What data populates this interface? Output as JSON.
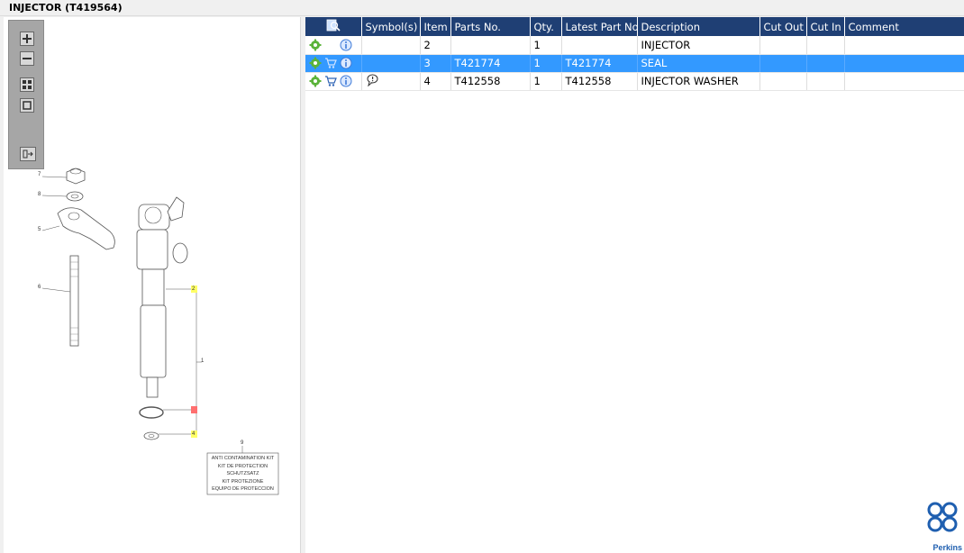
{
  "window": {
    "title": "INJECTOR (T419564)"
  },
  "diagram": {
    "callouts": [
      "7",
      "8",
      "5",
      "6",
      "2",
      "1",
      "4",
      "9"
    ],
    "kit_label": [
      "ANTI CONTAMINATION KIT",
      "KIT DE PROTECTION",
      "SCHUTZSATZ",
      "KIT PROTEZIONE",
      "EQUIPO DE PROTECCION"
    ],
    "zoom_tools": [
      "zoom-in-icon",
      "zoom-out-icon",
      "fit-all-icon",
      "fit-window-icon",
      "toggle-panel-icon"
    ]
  },
  "table": {
    "columns": [
      "Symbol(s)",
      "Item",
      "Parts No.",
      "Qty.",
      "Latest Part No.",
      "Description",
      "Cut Out",
      "Cut In",
      "Comment"
    ],
    "rows": [
      {
        "item": "2",
        "part_no": "",
        "qty": "1",
        "latest_part_no": "",
        "description": "INJECTOR",
        "cut_out": "",
        "cut_in": "",
        "comment": "",
        "has_cart": false,
        "has_note": false,
        "selected": false
      },
      {
        "item": "3",
        "part_no": "T421774",
        "qty": "1",
        "latest_part_no": "T421774",
        "description": "SEAL",
        "cut_out": "",
        "cut_in": "",
        "comment": "",
        "has_cart": true,
        "has_note": false,
        "selected": true
      },
      {
        "item": "4",
        "part_no": "T412558",
        "qty": "1",
        "latest_part_no": "T412558",
        "description": "INJECTOR WASHER",
        "cut_out": "",
        "cut_in": "",
        "comment": "",
        "has_cart": true,
        "has_note": true,
        "selected": false
      }
    ]
  },
  "brand": {
    "name": "Perkins",
    "color": "#1f5fb0"
  },
  "colors": {
    "header_bg": "#1f3f74",
    "selected_row": "#3399ff",
    "callout_yellow": "#ffff66",
    "callout_red": "#ff6f6f"
  }
}
